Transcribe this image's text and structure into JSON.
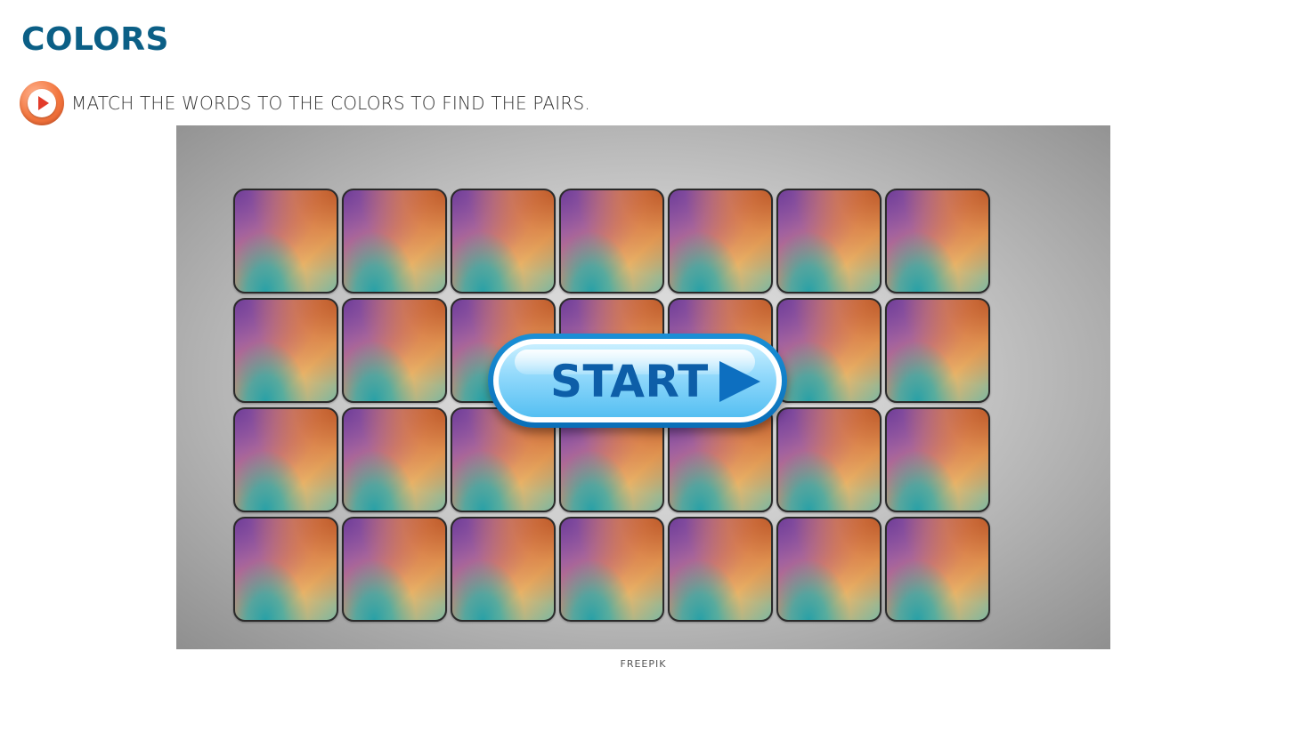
{
  "page": {
    "title": "COLORS",
    "instruction": "MATCH THE WORDS TO THE COLORS TO FIND THE PAIRS.",
    "audio_icon": "play-audio-icon",
    "credit": "FREEPIK"
  },
  "game": {
    "grid": {
      "rows": 4,
      "columns": 7
    },
    "cards": [
      {
        "state": "face-down"
      },
      {
        "state": "face-down"
      },
      {
        "state": "face-down"
      },
      {
        "state": "face-down"
      },
      {
        "state": "face-down"
      },
      {
        "state": "face-down"
      },
      {
        "state": "face-down"
      },
      {
        "state": "face-down"
      },
      {
        "state": "face-down"
      },
      {
        "state": "face-down"
      },
      {
        "state": "face-down"
      },
      {
        "state": "face-down"
      },
      {
        "state": "face-down"
      },
      {
        "state": "face-down"
      },
      {
        "state": "face-down"
      },
      {
        "state": "face-down"
      },
      {
        "state": "face-down"
      },
      {
        "state": "face-down"
      },
      {
        "state": "face-down"
      },
      {
        "state": "face-down"
      },
      {
        "state": "face-down"
      },
      {
        "state": "face-down"
      },
      {
        "state": "face-down"
      },
      {
        "state": "face-down"
      },
      {
        "state": "face-down"
      },
      {
        "state": "face-down"
      },
      {
        "state": "face-down"
      },
      {
        "state": "face-down"
      }
    ],
    "start_button": {
      "label": "START",
      "icon": "play-arrow-icon"
    }
  },
  "colors": {
    "title": "#0b5f86",
    "audio_button": "#f2763e",
    "start_text": "#0d5ea8",
    "start_arrow": "#0d6fc0",
    "start_border": "#0a6fb8"
  }
}
